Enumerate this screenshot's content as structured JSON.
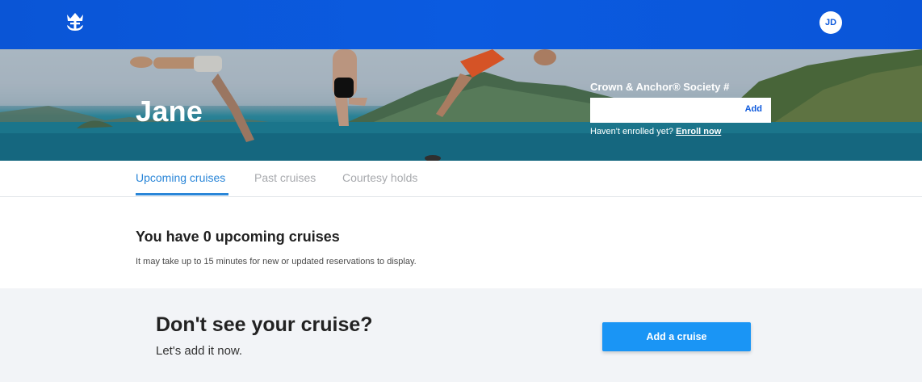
{
  "header": {
    "logo_icon": "crown-anchor-icon",
    "avatar_initials": "JD"
  },
  "hero": {
    "name": "Jane",
    "crown_anchor_label": "Crown & Anchor® Society #",
    "crown_anchor_value": "",
    "add_label": "Add",
    "enroll_prompt": "Haven't enrolled yet?",
    "enroll_link": "Enroll now"
  },
  "tabs": [
    {
      "label": "Upcoming cruises",
      "active": true
    },
    {
      "label": "Past cruises",
      "active": false
    },
    {
      "label": "Courtesy holds",
      "active": false
    }
  ],
  "main": {
    "title": "You have 0 upcoming cruises",
    "note": "It may take up to 15 minutes for new or updated reservations to display."
  },
  "band": {
    "title": "Don't see your cruise?",
    "subtitle": "Let's add it now.",
    "button_label": "Add a cruise"
  },
  "colors": {
    "nav_blue": "#0b58dc",
    "accent_blue": "#2a86d8",
    "button_blue": "#1a95f5",
    "band_bg": "#f2f4f7"
  }
}
